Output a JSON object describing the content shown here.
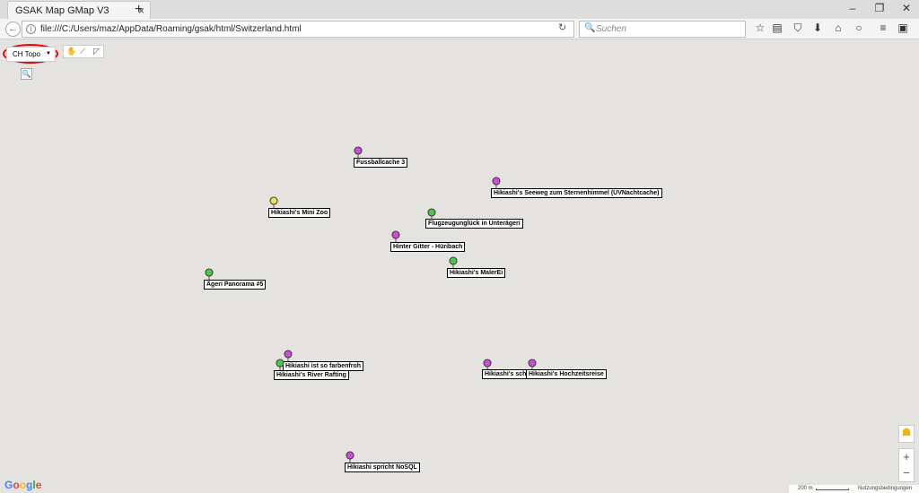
{
  "browser": {
    "tab_title": "GSAK Map GMap V3",
    "tab_close": "×",
    "new_tab": "+",
    "url": "file:///C:/Users/maz/AppData/Roaming/gsak/html/Switzerland.html",
    "search_placeholder": "Suchen",
    "minimize": "–",
    "restore": "❐",
    "close": "✕"
  },
  "map": {
    "map_type_label": "CH Topo",
    "zoom_plus": "+",
    "zoom_minus": "−",
    "google_logo": "Google",
    "scale_label": "200 m",
    "terms_label": "Nutzungsbedingungen",
    "colors": {
      "magenta": "#c84fd6",
      "green": "#4fc64a",
      "yellow": "#e8e054"
    },
    "markers": [
      {
        "name": "Fussballcache 3",
        "color": "magenta"
      },
      {
        "name": "Hikiashi's Seeweg zum Sternenhimmel (UVNachtcache)",
        "color": "magenta"
      },
      {
        "name": "Hikiashi's Mini Zoo",
        "color": "yellow"
      },
      {
        "name": "Flugzeugunglück in Unterägeri",
        "color": "green"
      },
      {
        "name": "Hinter Gitter - Hüribach",
        "color": "magenta"
      },
      {
        "name": "Hikiashi's MalerEi",
        "color": "green"
      },
      {
        "name": "Ägeri Panorama #5",
        "color": "green"
      },
      {
        "name": "Hikiashi ist so farbenfroh",
        "color": "magenta"
      },
      {
        "name": "Hikiashi's River Rafting",
        "color": "green"
      },
      {
        "name": "Hikiashi's schö",
        "color": "magenta"
      },
      {
        "name": "Hikiashi's Hochzeitsreise",
        "color": "magenta"
      },
      {
        "name": "Hikiashi spricht NoSQL",
        "color": "magenta"
      }
    ]
  }
}
